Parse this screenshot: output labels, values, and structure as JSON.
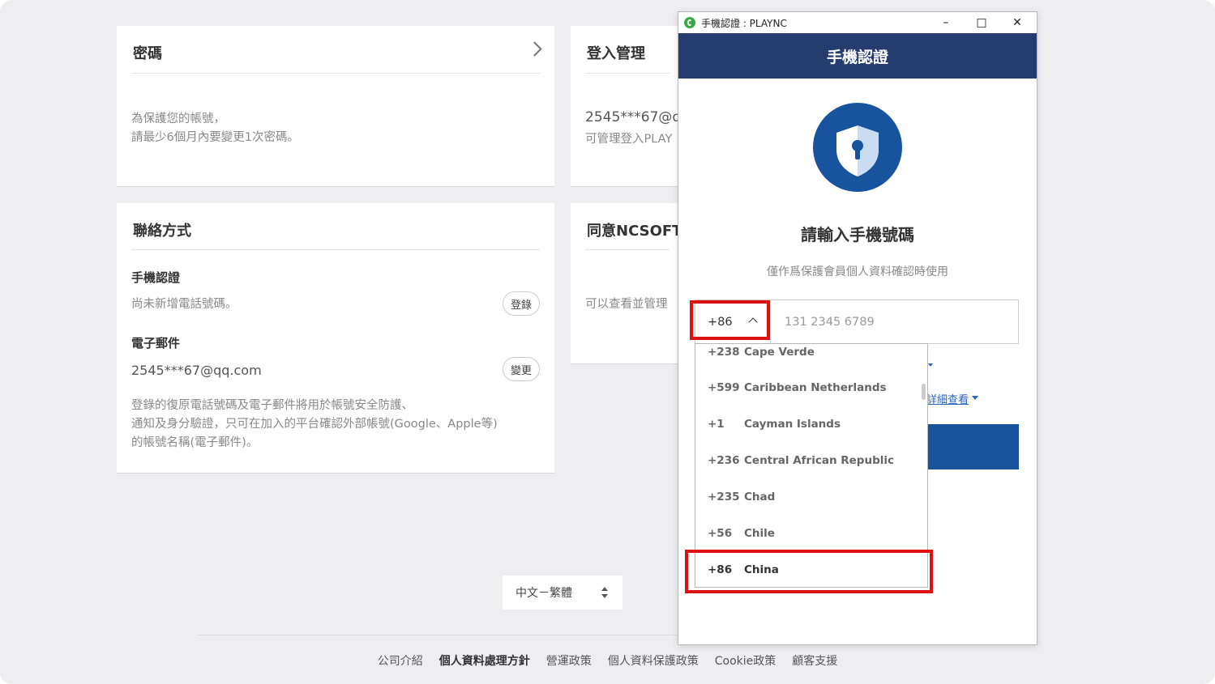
{
  "cards": {
    "password": {
      "title": "密碼",
      "desc1": "為保護您的帳號，",
      "desc2": "請最少6個月內要變更1次密碼。"
    },
    "login_mgmt": {
      "title": "登入管理",
      "email": "2545***67@q",
      "desc": "可管理登入PLAY"
    },
    "contact": {
      "title": "聯絡方式",
      "phone_title": "手機認證",
      "phone_desc": "尚未新增電話號碼。",
      "phone_btn": "登錄",
      "email_title": "電子郵件",
      "email_value": "2545***67@qq.com",
      "email_btn": "變更",
      "note1": "登錄的復原電話號碼及電子郵件將用於帳號安全防護、",
      "note2": "通知及身分驗證，只可在加入的平台確認外部帳號(Google、Apple等)",
      "note3": "的帳號名稱(電子郵件)。"
    },
    "consent": {
      "title": "同意NCSOFT",
      "desc": "可以查看並管理"
    }
  },
  "language": {
    "value": "中文－繁體"
  },
  "footer": {
    "links": [
      {
        "label": "公司介紹"
      },
      {
        "label": "個人資料處理方針"
      },
      {
        "label": "營運政策"
      },
      {
        "label": "個人資料保護政策"
      },
      {
        "label": "Cookie政策"
      },
      {
        "label": "顧客支援"
      }
    ]
  },
  "popup": {
    "window_title": "手機認證 : PLAYNC",
    "header": "手機認證",
    "title": "請輸入手機號碼",
    "subtitle": "僅作爲保護會員個人資料確認時使用",
    "country_code": "+86",
    "phone_placeholder": "131 2345 6789",
    "detail_link": "詳細查看",
    "icons": [
      "app-icon",
      "shield-lock-icon",
      "chevron-up-icon",
      "caret-down-icon"
    ]
  },
  "dropdown": {
    "options": [
      {
        "code": "+238",
        "name": "Cape Verde"
      },
      {
        "code": "+599",
        "name": "Caribbean Netherlands"
      },
      {
        "code": "+1",
        "name": "Cayman Islands"
      },
      {
        "code": "+236",
        "name": "Central African Republic"
      },
      {
        "code": "+235",
        "name": "Chad"
      },
      {
        "code": "+56",
        "name": "Chile"
      },
      {
        "code": "+86",
        "name": "China"
      }
    ]
  },
  "colors": {
    "header_navy": "#243c6e",
    "shield_blue": "#18539d",
    "button_blue": "#18529b",
    "highlight_red": "#dd1111",
    "link_blue": "#2a64c4"
  }
}
